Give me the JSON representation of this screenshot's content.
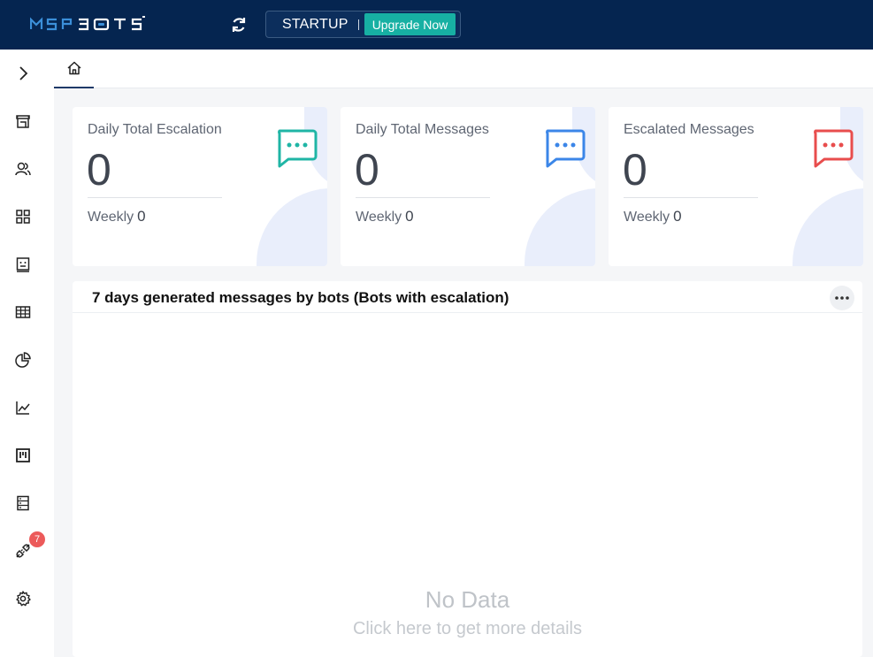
{
  "header": {
    "logo_text": "MSPBOTS",
    "plan": "STARTUP",
    "upgrade_label": "Upgrade Now"
  },
  "sidebar": {
    "items": [
      {
        "icon": "chevron-right-icon"
      },
      {
        "icon": "store-icon"
      },
      {
        "icon": "users-icon"
      },
      {
        "icon": "grid-icon"
      },
      {
        "icon": "bot-icon"
      },
      {
        "icon": "table-icon"
      },
      {
        "icon": "pie-chart-icon"
      },
      {
        "icon": "line-chart-icon"
      },
      {
        "icon": "board-icon"
      },
      {
        "icon": "server-icon"
      },
      {
        "icon": "plug-icon"
      },
      {
        "icon": "gear-icon"
      }
    ],
    "integration_badge": "7"
  },
  "tabs": [
    {
      "icon": "home-icon"
    }
  ],
  "cards": [
    {
      "title": "Daily Total Escalation",
      "value": "0",
      "weekly_label": "Weekly",
      "weekly_value": "0",
      "icon_color": "#1fb5a5"
    },
    {
      "title": "Daily Total Messages",
      "value": "0",
      "weekly_label": "Weekly",
      "weekly_value": "0",
      "icon_color": "#3b86e8"
    },
    {
      "title": "Escalated Messages",
      "value": "0",
      "weekly_label": "Weekly",
      "weekly_value": "0",
      "icon_color": "#e84d4d"
    }
  ],
  "panel": {
    "title": "7 days generated messages by bots (Bots with escalation)",
    "empty_title": "No Data",
    "empty_link": "Click here to get more details"
  },
  "colors": {
    "topbar": "#052550",
    "accent": "#17b0a3"
  }
}
